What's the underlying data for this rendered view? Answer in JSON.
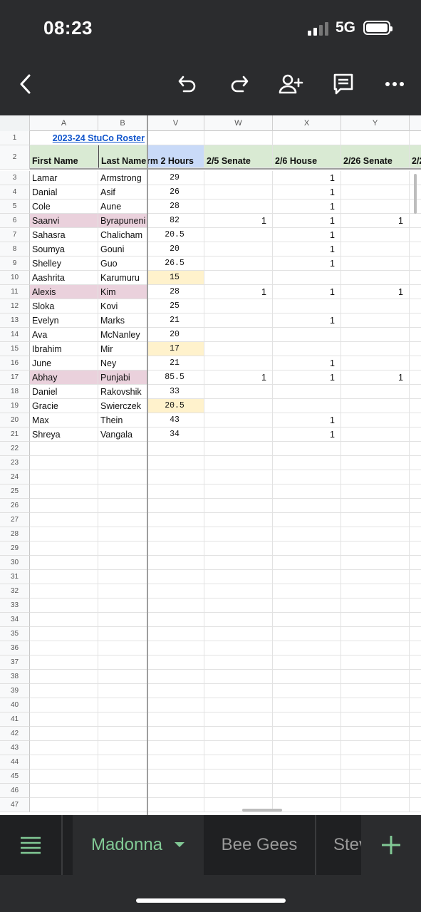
{
  "status": {
    "time": "08:23",
    "network": "5G"
  },
  "toolbar": {
    "icons": [
      "back-icon",
      "undo-icon",
      "redo-icon",
      "add-person-icon",
      "comment-icon",
      "more-icon"
    ]
  },
  "sheet": {
    "column_headers": [
      "A",
      "B",
      "V",
      "W",
      "X",
      "Y",
      ""
    ],
    "title": "2023-24 StuCo Roster",
    "headers": [
      "First Name",
      "Last Name",
      "rm 2 Hours",
      "2/5 Senate",
      "2/6 House",
      "2/26 Senate",
      "2/2"
    ],
    "rows": [
      {
        "n": "3",
        "first": "Lamar",
        "last": "Armstrong",
        "v": "29",
        "w": "",
        "x": "1",
        "y": "",
        "pink": false,
        "yellow": false
      },
      {
        "n": "4",
        "first": "Danial",
        "last": "Asif",
        "v": "26",
        "w": "",
        "x": "1",
        "y": "",
        "pink": false,
        "yellow": false
      },
      {
        "n": "5",
        "first": "Cole",
        "last": "Aune",
        "v": "28",
        "w": "",
        "x": "1",
        "y": "",
        "pink": false,
        "yellow": false
      },
      {
        "n": "6",
        "first": "Saanvi",
        "last": "Byrapuneni",
        "v": "82",
        "w": "1",
        "x": "1",
        "y": "1",
        "pink": true,
        "yellow": false
      },
      {
        "n": "7",
        "first": "Sahasra",
        "last": "Chalicham",
        "v": "20.5",
        "w": "",
        "x": "1",
        "y": "",
        "pink": false,
        "yellow": false
      },
      {
        "n": "8",
        "first": "Soumya",
        "last": "Gouni",
        "v": "20",
        "w": "",
        "x": "1",
        "y": "",
        "pink": false,
        "yellow": false
      },
      {
        "n": "9",
        "first": "Shelley",
        "last": "Guo",
        "v": "26.5",
        "w": "",
        "x": "1",
        "y": "",
        "pink": false,
        "yellow": false
      },
      {
        "n": "10",
        "first": "Aashrita",
        "last": "Karumuru",
        "v": "15",
        "w": "",
        "x": "",
        "y": "",
        "pink": false,
        "yellow": true
      },
      {
        "n": "11",
        "first": "Alexis",
        "last": "Kim",
        "v": "28",
        "w": "1",
        "x": "1",
        "y": "1",
        "pink": true,
        "yellow": false
      },
      {
        "n": "12",
        "first": "Sloka",
        "last": "Kovi",
        "v": "25",
        "w": "",
        "x": "",
        "y": "",
        "pink": false,
        "yellow": false
      },
      {
        "n": "13",
        "first": "Evelyn",
        "last": "Marks",
        "v": "21",
        "w": "",
        "x": "1",
        "y": "",
        "pink": false,
        "yellow": false
      },
      {
        "n": "14",
        "first": "Ava",
        "last": "McNanley",
        "v": "20",
        "w": "",
        "x": "",
        "y": "",
        "pink": false,
        "yellow": false
      },
      {
        "n": "15",
        "first": "Ibrahim",
        "last": "Mir",
        "v": "17",
        "w": "",
        "x": "",
        "y": "",
        "pink": false,
        "yellow": true
      },
      {
        "n": "16",
        "first": "June",
        "last": "Ney",
        "v": "21",
        "w": "",
        "x": "1",
        "y": "",
        "pink": false,
        "yellow": false
      },
      {
        "n": "17",
        "first": "Abhay",
        "last": "Punjabi",
        "v": "85.5",
        "w": "1",
        "x": "1",
        "y": "1",
        "pink": true,
        "yellow": false
      },
      {
        "n": "18",
        "first": "Daniel",
        "last": "Rakovshik",
        "v": "33",
        "w": "",
        "x": "",
        "y": "",
        "pink": false,
        "yellow": false
      },
      {
        "n": "19",
        "first": "Gracie",
        "last": "Swierczek",
        "v": "20.5",
        "w": "",
        "x": "",
        "y": "",
        "pink": false,
        "yellow": true
      },
      {
        "n": "20",
        "first": "Max",
        "last": "Thein",
        "v": "43",
        "w": "",
        "x": "1",
        "y": "",
        "pink": false,
        "yellow": false
      },
      {
        "n": "21",
        "first": "Shreya",
        "last": "Vangala",
        "v": "34",
        "w": "",
        "x": "1",
        "y": "",
        "pink": false,
        "yellow": false
      }
    ],
    "empty_rows": [
      "22",
      "23",
      "24",
      "25",
      "26",
      "27",
      "28",
      "29",
      "30",
      "31",
      "32",
      "33",
      "34",
      "35",
      "36",
      "37",
      "38",
      "39",
      "40",
      "41",
      "42",
      "43",
      "44",
      "45",
      "46",
      "47"
    ]
  },
  "tabs": {
    "menu_icon": "sheets-list-icon",
    "active": "Madonna",
    "others": [
      "Bee Gees",
      "Stev"
    ],
    "add_icon": "plus-icon"
  },
  "colors": {
    "pink_highlight": "#ead1dc",
    "yellow_highlight": "#fff2cc",
    "header_green": "#d9ead3",
    "header_blue": "#c9daf8",
    "active_tab_green": "#81c995"
  }
}
